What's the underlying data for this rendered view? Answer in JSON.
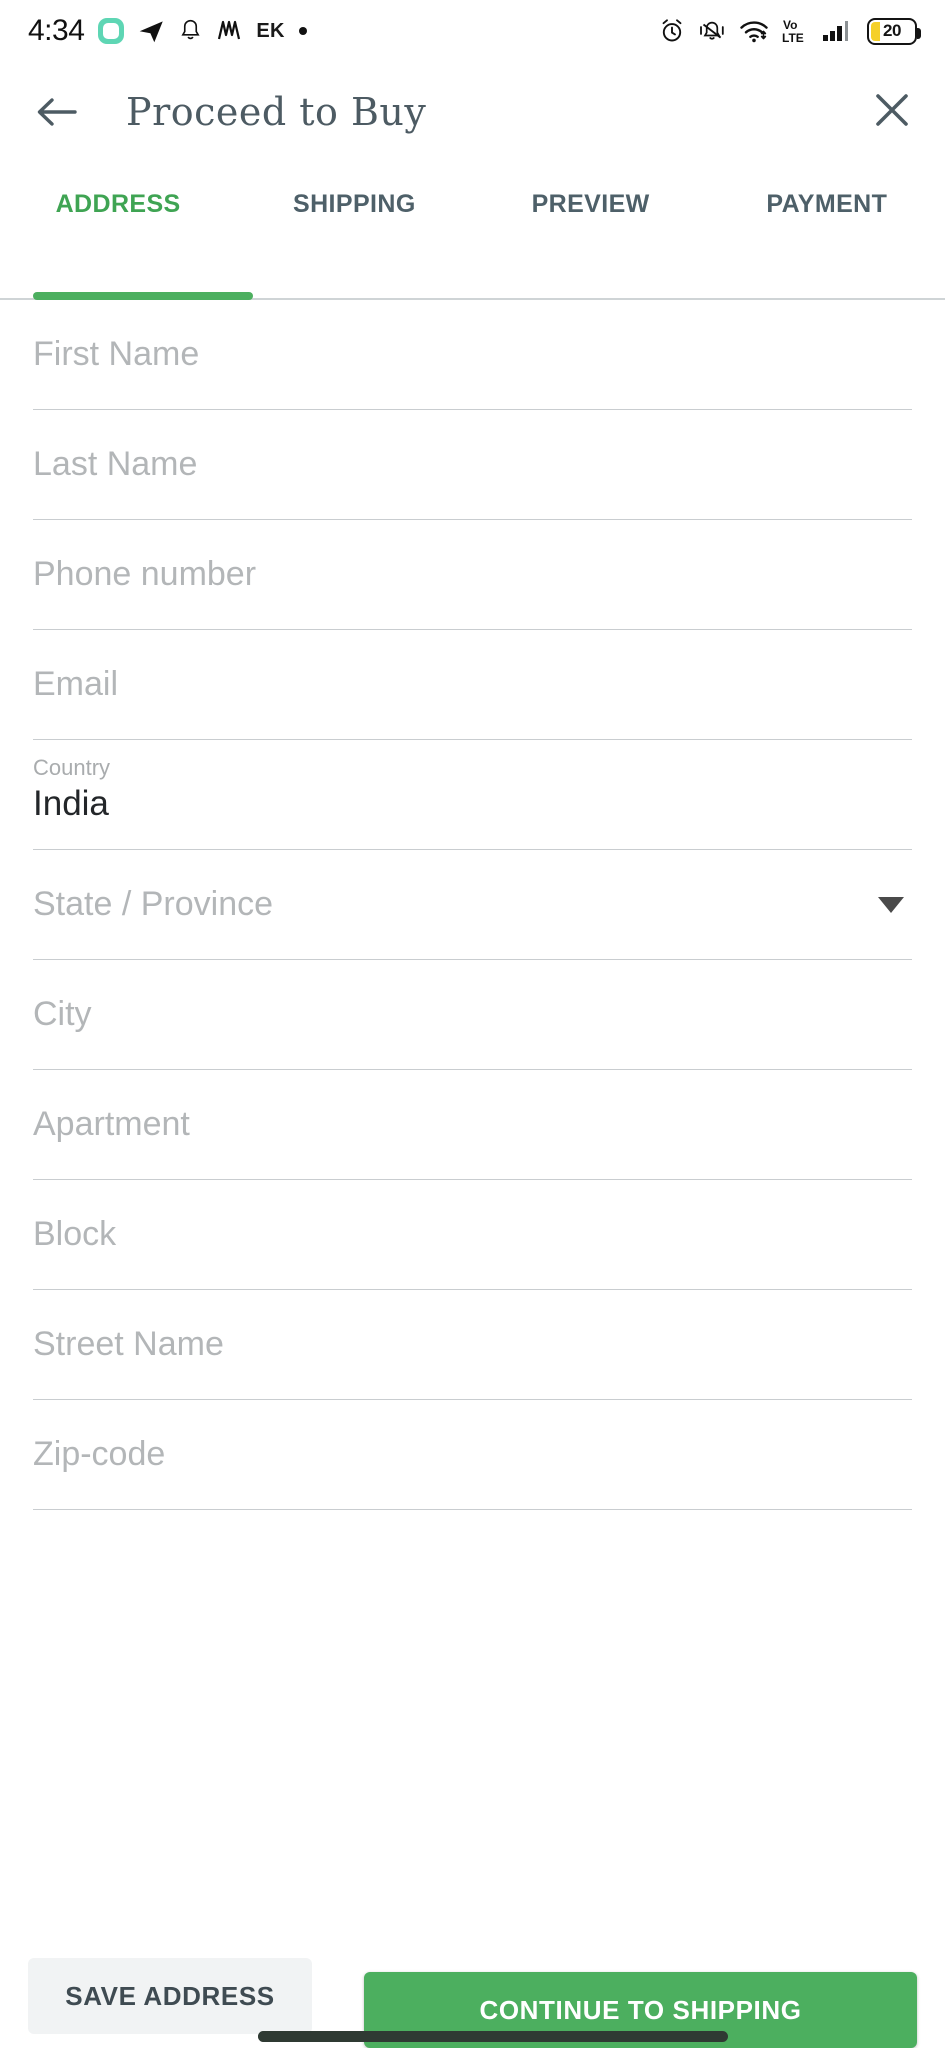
{
  "status_bar": {
    "time": "4:34",
    "left_icons": [
      "rounded-square-teal-icon",
      "telegram-send-icon",
      "bell-icon",
      "m-logo-icon",
      "ek-text-icon",
      "dot-icon"
    ],
    "ek_label": "EK",
    "right_icons": [
      "alarm-clock-icon",
      "bell-vibrate-icon",
      "wifi-icon",
      "volte-icon",
      "signal-bars-icon"
    ],
    "volte_top": "Vo",
    "volte_bottom": "LTE",
    "battery_level": "20"
  },
  "app_bar": {
    "title": "Proceed to Buy",
    "back_label": "back-arrow",
    "close_label": "close"
  },
  "tabs": {
    "items": [
      {
        "label": "ADDRESS",
        "active": true
      },
      {
        "label": "SHIPPING",
        "active": false
      },
      {
        "label": "PREVIEW",
        "active": false
      },
      {
        "label": "PAYMENT",
        "active": false
      }
    ],
    "active_index": 0,
    "active_color": "#3fa453",
    "inactive_color": "#4e6069",
    "indicator_color": "#4caf5f"
  },
  "form": {
    "fields": [
      {
        "name": "first-name",
        "placeholder": "First Name",
        "value": "",
        "type": "text"
      },
      {
        "name": "last-name",
        "placeholder": "Last Name",
        "value": "",
        "type": "text"
      },
      {
        "name": "phone-number",
        "placeholder": "Phone number",
        "value": "",
        "type": "text"
      },
      {
        "name": "email",
        "placeholder": "Email",
        "value": "",
        "type": "text"
      },
      {
        "name": "country",
        "placeholder": "Country",
        "value": "India",
        "type": "filled"
      },
      {
        "name": "state-province",
        "placeholder": "State / Province",
        "value": "",
        "type": "select"
      },
      {
        "name": "city",
        "placeholder": "City",
        "value": "",
        "type": "text"
      },
      {
        "name": "apartment",
        "placeholder": "Apartment",
        "value": "",
        "type": "text"
      },
      {
        "name": "block",
        "placeholder": "Block",
        "value": "",
        "type": "text"
      },
      {
        "name": "street-name",
        "placeholder": "Street Name",
        "value": "",
        "type": "text"
      },
      {
        "name": "zip-code",
        "placeholder": "Zip-code",
        "value": "",
        "type": "text"
      }
    ],
    "field_labels": {
      "first_name": "First Name",
      "last_name": "Last Name",
      "phone_number": "Phone number",
      "email": "Email",
      "country_label": "Country",
      "country_value": "India",
      "state_province": "State / Province",
      "city": "City",
      "apartment": "Apartment",
      "block": "Block",
      "street_name": "Street Name",
      "zip_code": "Zip-code"
    }
  },
  "bottom_bar": {
    "save_label": "SAVE ADDRESS",
    "continue_label": "CONTINUE TO SHIPPING",
    "continue_color": "#4caf5f",
    "save_bg": "#f1f3f4"
  }
}
